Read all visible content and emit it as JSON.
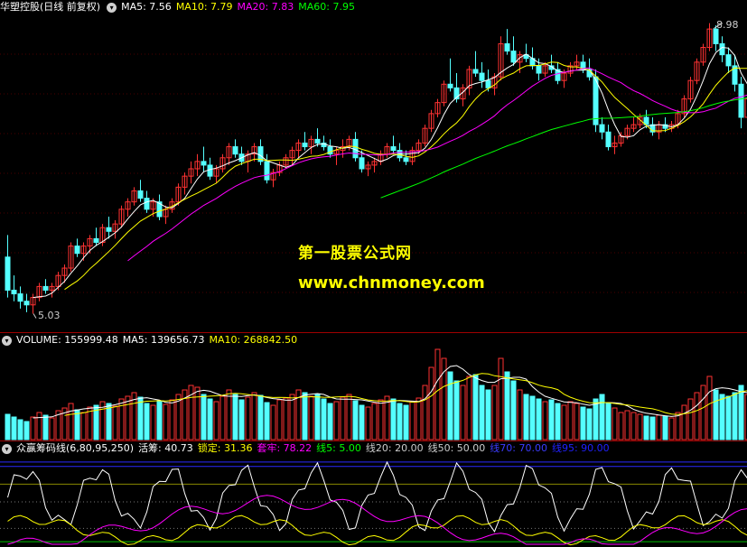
{
  "main_header": {
    "title": "华塑控股(日线 前复权)",
    "ma5": "MA5: 7.56",
    "ma10": "MA10: 7.79",
    "ma20": "MA20: 7.83",
    "ma60": "MA60: 7.95"
  },
  "price_high_label": "8.98",
  "price_low_label": "5.03",
  "watermark": {
    "line1": "第一股票公式网",
    "line2": "www.chnmoney.com"
  },
  "volume_header": {
    "volume": "VOLUME: 155999.48",
    "ma5": "MA5: 139656.73",
    "ma10": "MA10: 268842.50"
  },
  "indicator_header": {
    "name": "众赢筹码线(6,80,95,250)",
    "huochou": "活筹: 40.73",
    "suoding": "锁定: 31.36",
    "taolao": "套牢: 78.22",
    "xian5": "线5: 5.00",
    "xian20": "线20: 20.00",
    "xian50": "线50: 50.00",
    "xian70": "线70: 70.00",
    "xian95": "线95: 90.00"
  },
  "colors": {
    "up": "#ff3232",
    "down": "#54ffff",
    "ma5": "#ffffff",
    "ma10": "#ffff00",
    "ma20": "#ff00ff",
    "ma60": "#00ff00",
    "frame": "#a00000"
  },
  "chart_data": {
    "type": "candlestick",
    "y_range": [
      5.03,
      8.98
    ],
    "ma_labels": [
      "MA5",
      "MA10",
      "MA20",
      "MA60"
    ],
    "candles": [
      [
        5.8,
        6.1,
        5.25,
        5.35
      ],
      [
        5.35,
        5.55,
        5.2,
        5.3
      ],
      [
        5.3,
        5.4,
        5.1,
        5.2
      ],
      [
        5.2,
        5.3,
        5.05,
        5.15
      ],
      [
        5.15,
        5.3,
        5.03,
        5.25
      ],
      [
        5.25,
        5.45,
        5.2,
        5.4
      ],
      [
        5.4,
        5.5,
        5.3,
        5.35
      ],
      [
        5.35,
        5.45,
        5.25,
        5.4
      ],
      [
        5.4,
        5.6,
        5.35,
        5.55
      ],
      [
        5.55,
        5.7,
        5.45,
        5.65
      ],
      [
        5.65,
        6.0,
        5.6,
        5.95
      ],
      [
        5.95,
        6.05,
        5.8,
        5.85
      ],
      [
        5.85,
        6.0,
        5.75,
        5.95
      ],
      [
        5.95,
        6.1,
        5.85,
        6.05
      ],
      [
        6.05,
        6.2,
        5.95,
        6.0
      ],
      [
        6.0,
        6.25,
        5.95,
        6.2
      ],
      [
        6.2,
        6.35,
        6.05,
        6.15
      ],
      [
        6.15,
        6.3,
        6.05,
        6.25
      ],
      [
        6.25,
        6.5,
        6.2,
        6.45
      ],
      [
        6.45,
        6.6,
        6.35,
        6.55
      ],
      [
        6.55,
        6.75,
        6.5,
        6.7
      ],
      [
        6.7,
        6.85,
        6.55,
        6.6
      ],
      [
        6.6,
        6.7,
        6.4,
        6.45
      ],
      [
        6.45,
        6.6,
        6.35,
        6.55
      ],
      [
        6.55,
        6.65,
        6.3,
        6.35
      ],
      [
        6.35,
        6.5,
        6.25,
        6.45
      ],
      [
        6.45,
        6.6,
        6.4,
        6.55
      ],
      [
        6.55,
        6.8,
        6.5,
        6.75
      ],
      [
        6.75,
        6.95,
        6.65,
        6.9
      ],
      [
        6.9,
        7.1,
        6.8,
        7.0
      ],
      [
        7.0,
        7.2,
        6.9,
        7.1
      ],
      [
        7.1,
        7.3,
        6.95,
        7.05
      ],
      [
        7.05,
        7.15,
        6.85,
        6.9
      ],
      [
        6.9,
        7.05,
        6.8,
        7.0
      ],
      [
        7.0,
        7.2,
        6.95,
        7.15
      ],
      [
        7.15,
        7.35,
        7.05,
        7.3
      ],
      [
        7.3,
        7.4,
        7.15,
        7.2
      ],
      [
        7.2,
        7.3,
        7.05,
        7.1
      ],
      [
        7.1,
        7.25,
        6.95,
        7.2
      ],
      [
        7.2,
        7.35,
        7.1,
        7.3
      ],
      [
        7.3,
        7.4,
        7.05,
        7.1
      ],
      [
        7.1,
        7.2,
        6.8,
        6.85
      ],
      [
        6.85,
        7.0,
        6.75,
        6.95
      ],
      [
        6.95,
        7.1,
        6.9,
        7.05
      ],
      [
        7.05,
        7.2,
        7.0,
        7.15
      ],
      [
        7.15,
        7.3,
        7.05,
        7.25
      ],
      [
        7.25,
        7.4,
        7.15,
        7.35
      ],
      [
        7.35,
        7.5,
        7.25,
        7.3
      ],
      [
        7.3,
        7.45,
        7.2,
        7.4
      ],
      [
        7.4,
        7.55,
        7.3,
        7.35
      ],
      [
        7.35,
        7.45,
        7.25,
        7.3
      ],
      [
        7.3,
        7.4,
        7.15,
        7.2
      ],
      [
        7.2,
        7.3,
        7.05,
        7.25
      ],
      [
        7.25,
        7.4,
        7.15,
        7.3
      ],
      [
        7.3,
        7.45,
        7.25,
        7.4
      ],
      [
        7.4,
        7.5,
        7.1,
        7.15
      ],
      [
        7.15,
        7.25,
        6.95,
        7.0
      ],
      [
        7.0,
        7.1,
        6.9,
        7.05
      ],
      [
        7.05,
        7.15,
        6.95,
        7.1
      ],
      [
        7.1,
        7.25,
        7.05,
        7.2
      ],
      [
        7.2,
        7.35,
        7.15,
        7.3
      ],
      [
        7.3,
        7.45,
        7.2,
        7.25
      ],
      [
        7.25,
        7.35,
        7.1,
        7.15
      ],
      [
        7.15,
        7.25,
        7.05,
        7.1
      ],
      [
        7.1,
        7.3,
        7.05,
        7.25
      ],
      [
        7.25,
        7.4,
        7.2,
        7.35
      ],
      [
        7.35,
        7.6,
        7.3,
        7.55
      ],
      [
        7.55,
        7.8,
        7.5,
        7.75
      ],
      [
        7.75,
        7.95,
        7.7,
        7.9
      ],
      [
        7.9,
        8.2,
        7.85,
        8.15
      ],
      [
        8.15,
        8.5,
        8.05,
        8.1
      ],
      [
        8.1,
        8.3,
        7.9,
        7.95
      ],
      [
        7.95,
        8.15,
        7.85,
        8.1
      ],
      [
        8.1,
        8.4,
        8.0,
        8.35
      ],
      [
        8.35,
        8.6,
        8.25,
        8.3
      ],
      [
        8.3,
        8.45,
        8.1,
        8.2
      ],
      [
        8.2,
        8.35,
        8.05,
        8.1
      ],
      [
        8.1,
        8.3,
        8.0,
        8.25
      ],
      [
        8.25,
        8.8,
        8.2,
        8.7
      ],
      [
        8.7,
        8.9,
        8.55,
        8.6
      ],
      [
        8.6,
        8.8,
        8.4,
        8.45
      ],
      [
        8.45,
        8.6,
        8.3,
        8.55
      ],
      [
        8.55,
        8.7,
        8.45,
        8.5
      ],
      [
        8.5,
        8.65,
        8.35,
        8.4
      ],
      [
        8.4,
        8.5,
        8.2,
        8.3
      ],
      [
        8.3,
        8.45,
        8.25,
        8.4
      ],
      [
        8.4,
        8.55,
        8.3,
        8.35
      ],
      [
        8.35,
        8.45,
        8.15,
        8.2
      ],
      [
        8.2,
        8.35,
        8.1,
        8.3
      ],
      [
        8.3,
        8.45,
        8.25,
        8.4
      ],
      [
        8.4,
        8.55,
        8.35,
        8.45
      ],
      [
        8.45,
        8.55,
        8.3,
        8.35
      ],
      [
        8.35,
        8.5,
        8.2,
        8.25
      ],
      [
        8.25,
        8.35,
        7.5,
        7.6
      ],
      [
        7.6,
        7.7,
        7.4,
        7.5
      ],
      [
        7.5,
        7.6,
        7.25,
        7.3
      ],
      [
        7.3,
        7.45,
        7.2,
        7.35
      ],
      [
        7.35,
        7.5,
        7.3,
        7.45
      ],
      [
        7.45,
        7.6,
        7.4,
        7.55
      ],
      [
        7.55,
        7.7,
        7.5,
        7.6
      ],
      [
        7.6,
        7.75,
        7.55,
        7.7
      ],
      [
        7.7,
        7.8,
        7.55,
        7.6
      ],
      [
        7.6,
        7.7,
        7.45,
        7.5
      ],
      [
        7.5,
        7.65,
        7.4,
        7.6
      ],
      [
        7.6,
        7.7,
        7.5,
        7.55
      ],
      [
        7.55,
        7.65,
        7.5,
        7.6
      ],
      [
        7.6,
        7.8,
        7.55,
        7.75
      ],
      [
        7.75,
        8.0,
        7.7,
        7.95
      ],
      [
        7.95,
        8.25,
        7.9,
        8.2
      ],
      [
        8.2,
        8.5,
        8.15,
        8.45
      ],
      [
        8.45,
        8.7,
        8.4,
        8.65
      ],
      [
        8.65,
        8.98,
        8.6,
        8.9
      ],
      [
        8.9,
        8.95,
        8.6,
        8.7
      ],
      [
        8.7,
        8.8,
        8.45,
        8.55
      ],
      [
        8.55,
        8.65,
        8.3,
        8.4
      ],
      [
        8.4,
        8.55,
        8.05,
        8.15
      ],
      [
        8.15,
        8.25,
        7.55,
        7.7
      ],
      [
        7.7,
        8.05,
        7.6,
        7.95
      ],
      [
        7.95,
        8.0,
        7.7,
        7.8
      ],
      [
        7.8,
        8.0,
        7.65,
        7.9
      ]
    ],
    "volumes": [
      0.28,
      0.25,
      0.22,
      0.2,
      0.25,
      0.3,
      0.27,
      0.24,
      0.32,
      0.35,
      0.4,
      0.33,
      0.3,
      0.36,
      0.38,
      0.42,
      0.4,
      0.37,
      0.45,
      0.48,
      0.52,
      0.47,
      0.4,
      0.38,
      0.42,
      0.39,
      0.44,
      0.5,
      0.55,
      0.6,
      0.58,
      0.5,
      0.45,
      0.42,
      0.48,
      0.55,
      0.5,
      0.44,
      0.47,
      0.52,
      0.49,
      0.41,
      0.38,
      0.44,
      0.46,
      0.5,
      0.55,
      0.52,
      0.48,
      0.5,
      0.45,
      0.4,
      0.42,
      0.47,
      0.5,
      0.43,
      0.38,
      0.36,
      0.4,
      0.44,
      0.48,
      0.45,
      0.4,
      0.38,
      0.42,
      0.46,
      0.6,
      0.8,
      1.0,
      0.9,
      0.75,
      0.65,
      0.6,
      0.7,
      0.72,
      0.6,
      0.55,
      0.6,
      0.9,
      0.75,
      0.65,
      0.55,
      0.5,
      0.48,
      0.45,
      0.42,
      0.44,
      0.4,
      0.38,
      0.42,
      0.4,
      0.36,
      0.34,
      0.45,
      0.5,
      0.4,
      0.35,
      0.3,
      0.32,
      0.3,
      0.28,
      0.26,
      0.25,
      0.27,
      0.26,
      0.24,
      0.3,
      0.38,
      0.45,
      0.52,
      0.6,
      0.7,
      0.55,
      0.5,
      0.48,
      0.52,
      0.6,
      0.5,
      0.45,
      0.42
    ],
    "indicator_levels": [
      5,
      20,
      50,
      70,
      90,
      95
    ]
  }
}
